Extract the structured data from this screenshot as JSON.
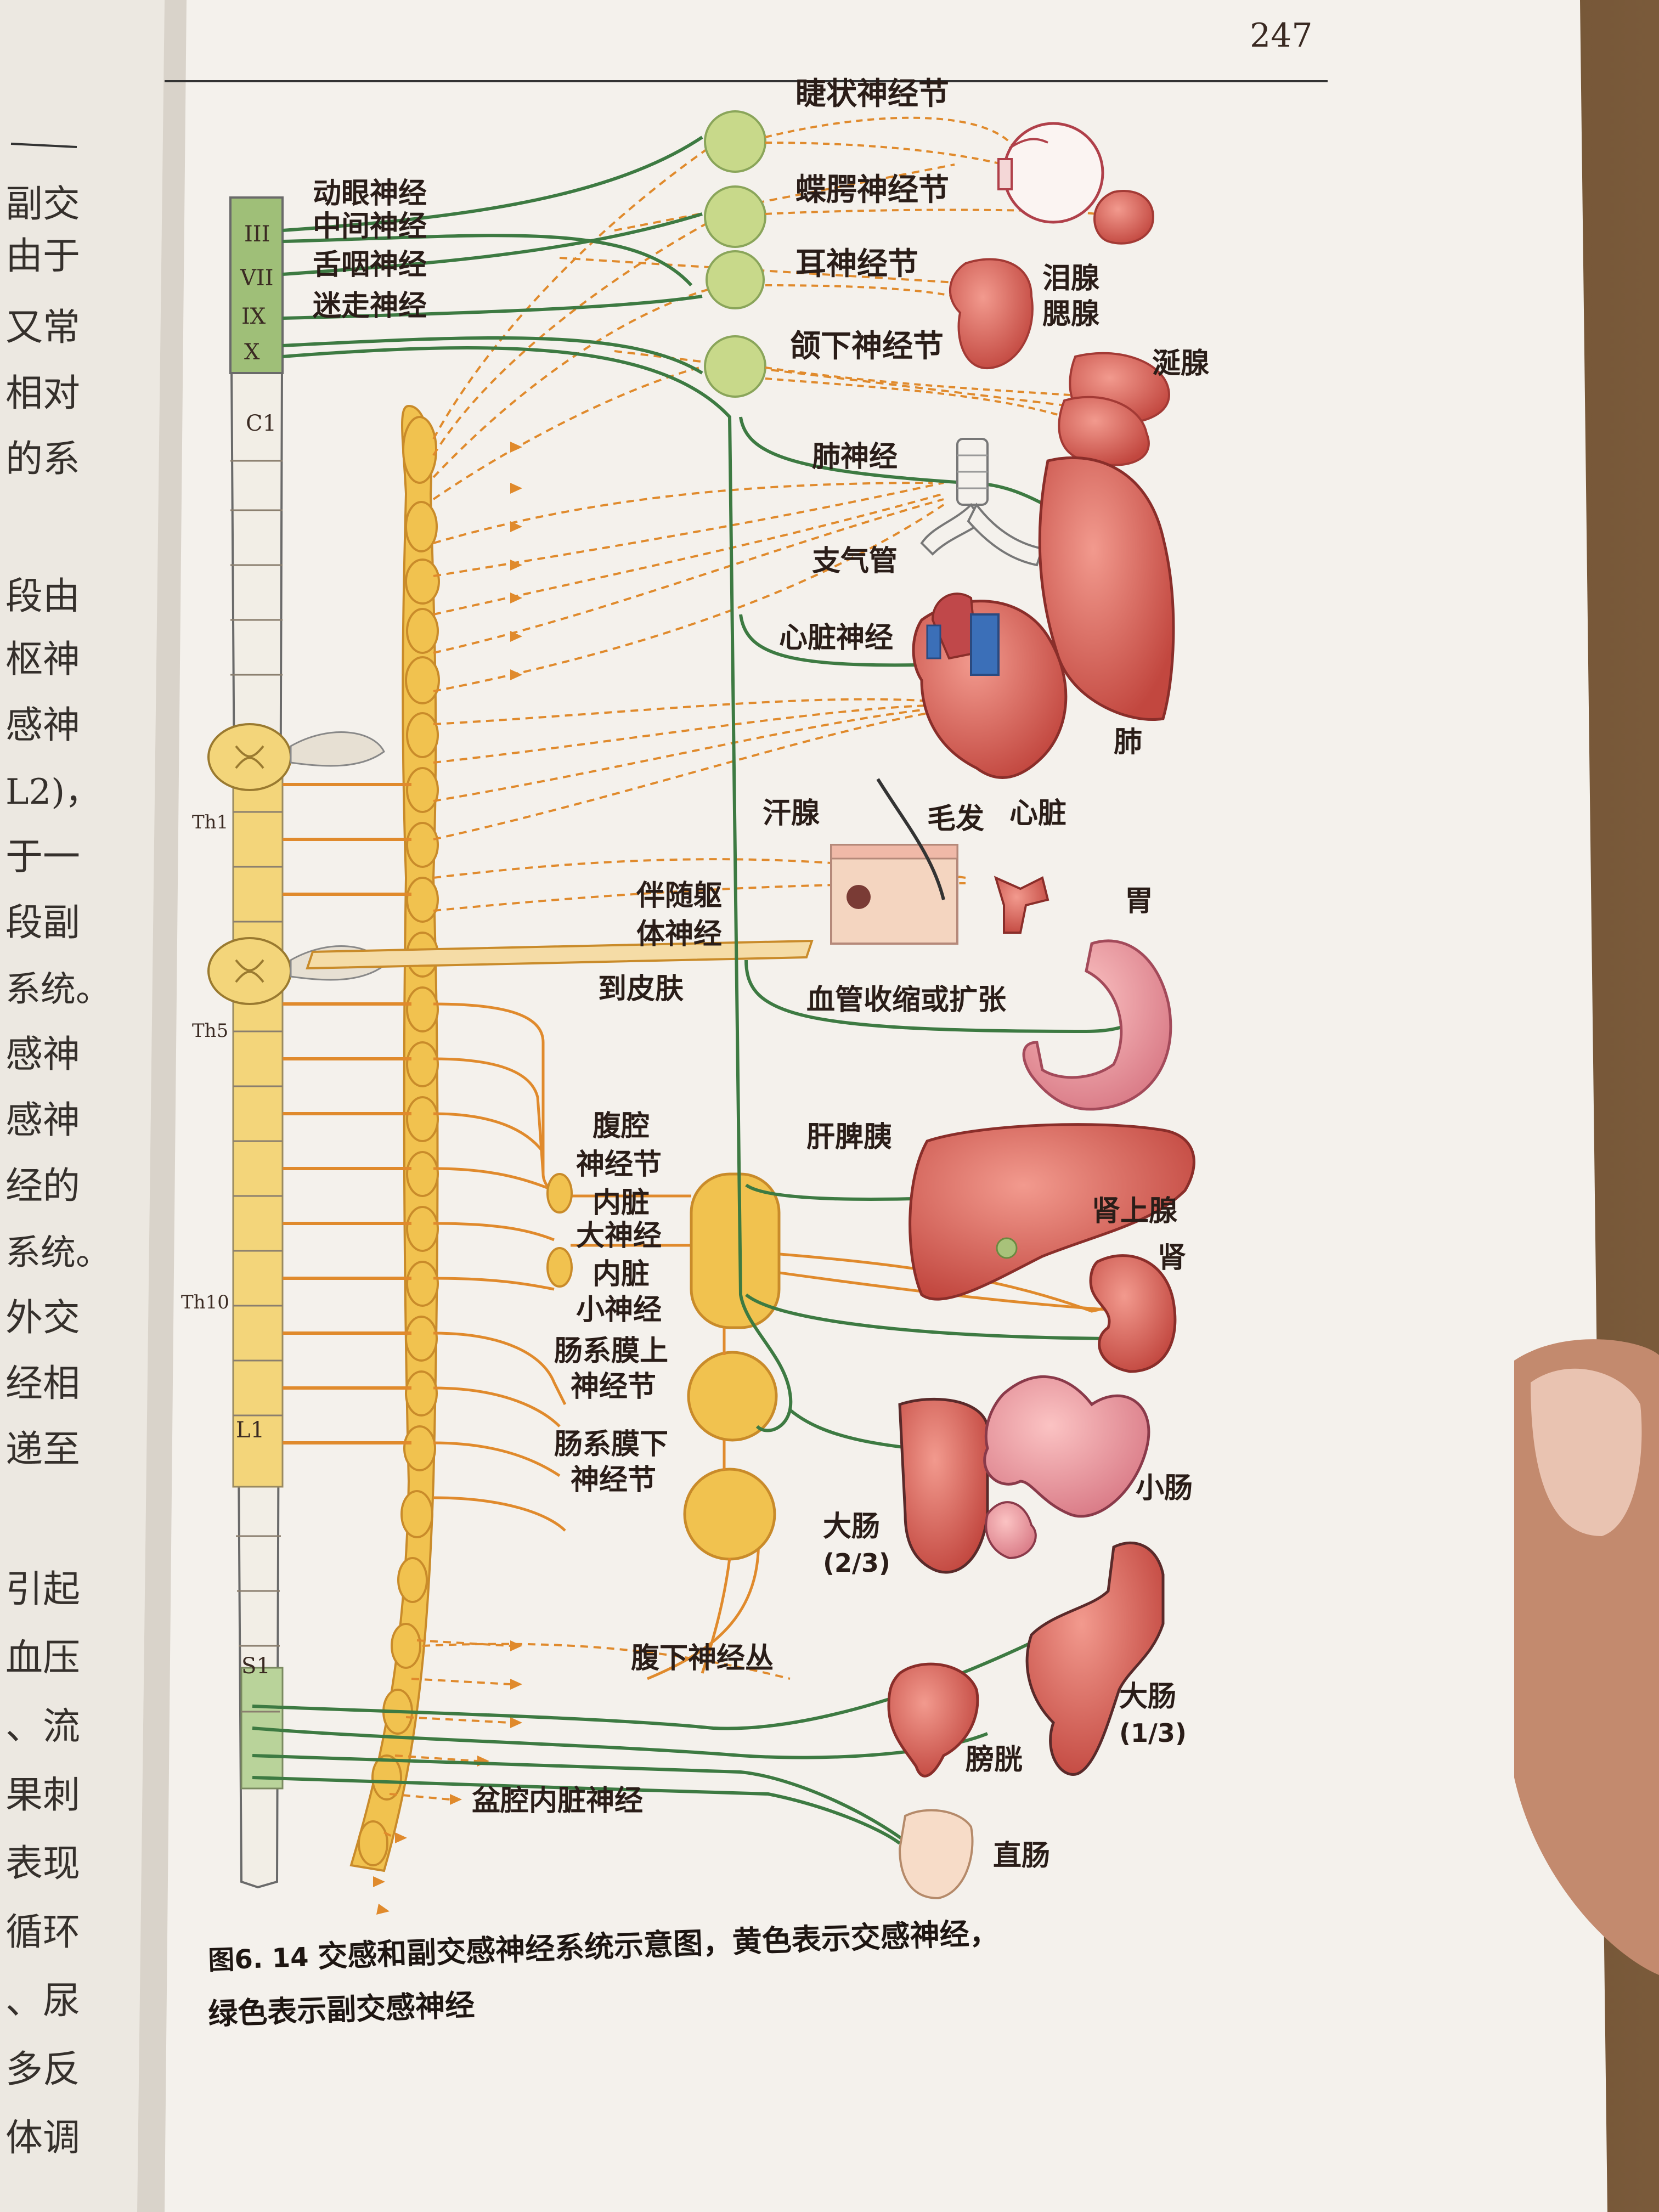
{
  "page_number": "247",
  "left_page_fragments": [
    "副交",
    "由于",
    "又常",
    "相对",
    "的系",
    "段由",
    "枢神",
    "感神",
    "L2)，",
    "于一",
    "段副",
    "系统。",
    "感神",
    "感神",
    "经的",
    "系统。",
    "外交",
    "经相",
    "递至",
    "引起",
    "血压",
    "、流",
    "果刺",
    "表现",
    "循环",
    "、尿",
    "多反",
    "体调"
  ],
  "cranial_segments": [
    "III",
    "VII",
    "IX",
    "X"
  ],
  "spinal_segments": [
    "C1",
    "Th1",
    "Th5",
    "Th10",
    "L1",
    "S1"
  ],
  "nerves": {
    "oculomotor": "动眼神经",
    "intermediate": "中间神经",
    "glossopharyngeal": "舌咽神经",
    "vagus": "迷走神经",
    "pulmonary": "肺神经",
    "cardiac": "心脏神经",
    "somatic_1": "伴随躯",
    "somatic_2": "体神经",
    "to_skin": "到皮肤",
    "pelvic": "盆腔内脏神经",
    "hypogastric": "腹下神经丛"
  },
  "ganglia": {
    "ciliary": "睫状神经节",
    "pterygopalatine": "蝶腭神经节",
    "otic": "耳神经节",
    "submandibular": "颌下神经节",
    "celiac_1": "腹腔",
    "celiac_2": "神经节",
    "gsn_1": "内脏",
    "gsn_2": "大神经",
    "lsn_1": "内脏",
    "lsn_2": "小神经",
    "smg_1": "肠系膜上",
    "smg_2": "神经节",
    "img_1": "肠系膜下",
    "img_2": "神经节"
  },
  "organs": {
    "lacrimal": "泪腺",
    "parotid": "腮腺",
    "salivary": "涎腺",
    "bronchus": "支气管",
    "lung": "肺",
    "heart": "心脏",
    "sweat": "汗腺",
    "hair": "毛发",
    "stomach": "胃",
    "vessel": "血管收缩或扩张",
    "liver_spleen_pancreas": "肝脾胰",
    "adrenal": "肾上腺",
    "kidney": "肾",
    "small_intestine": "小肠",
    "colon_a": "大肠",
    "colon_a_frac": "(2/3)",
    "colon_b": "大肠",
    "colon_b_frac": "(1/3)",
    "bladder": "膀胱",
    "rectum": "直肠"
  },
  "caption": {
    "label": "图6. 14",
    "line1": "交感和副交感神经系统示意图，黄色表示交感神经，",
    "line2": "绿色表示副交感神经"
  },
  "colors": {
    "sympathetic": "#e08a2c",
    "parasympathetic": "#3d7a42",
    "chain": "#f1c24f",
    "organ": "#d9675f"
  }
}
